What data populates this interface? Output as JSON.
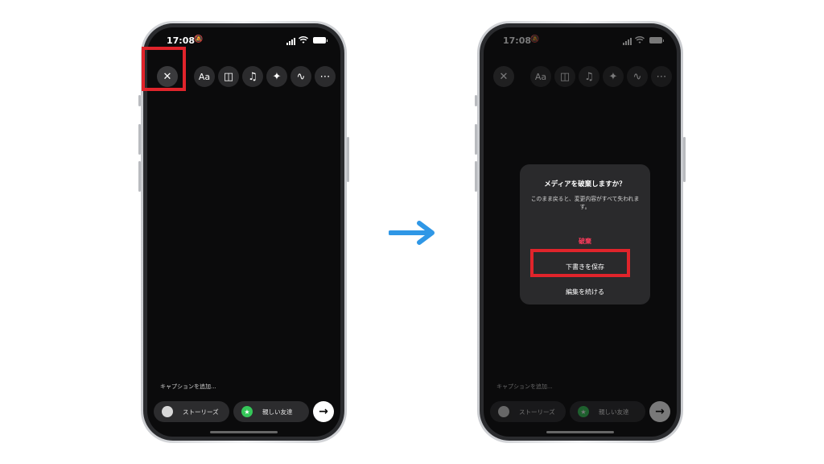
{
  "left_phone": {
    "status": {
      "time": "17:08"
    },
    "toolbar": {
      "close_glyph": "✕",
      "text_label": "Aa",
      "sticker_glyph": "◫",
      "music_glyph": "♫",
      "effects_glyph": "✦",
      "draw_glyph": "∿",
      "more_glyph": "⋯"
    },
    "caption_placeholder": "キャプションを追加...",
    "stories_label": "ストーリーズ",
    "close_friends_label": "親しい友達",
    "send_glyph": "→"
  },
  "right_phone": {
    "status": {
      "time": "17:08"
    },
    "toolbar": {
      "close_glyph": "✕",
      "text_label": "Aa",
      "sticker_glyph": "◫",
      "music_glyph": "♫",
      "effects_glyph": "✦",
      "draw_glyph": "∿",
      "more_glyph": "⋯"
    },
    "caption_placeholder": "キャプションを追加...",
    "stories_label": "ストーリーズ",
    "close_friends_label": "親しい友達",
    "send_glyph": "→",
    "dialog": {
      "title": "メディアを破棄しますか？",
      "message": "このまま戻ると、変更内容がすべて失われます。",
      "discard_label": "破棄",
      "save_draft_label": "下書きを保存",
      "continue_label": "編集を続ける"
    }
  },
  "colors": {
    "highlight": "#e0242b",
    "arrow": "#2f97e6",
    "discard": "#ff3b5c",
    "close_friends": "#35c759"
  },
  "icons": [
    "bell-mute-icon",
    "signal-icon",
    "wifi-icon",
    "battery-icon",
    "close-icon",
    "text-icon",
    "sticker-icon",
    "music-icon",
    "effects-icon",
    "draw-icon",
    "more-icon",
    "avatar",
    "star-icon",
    "arrow-right-icon"
  ]
}
